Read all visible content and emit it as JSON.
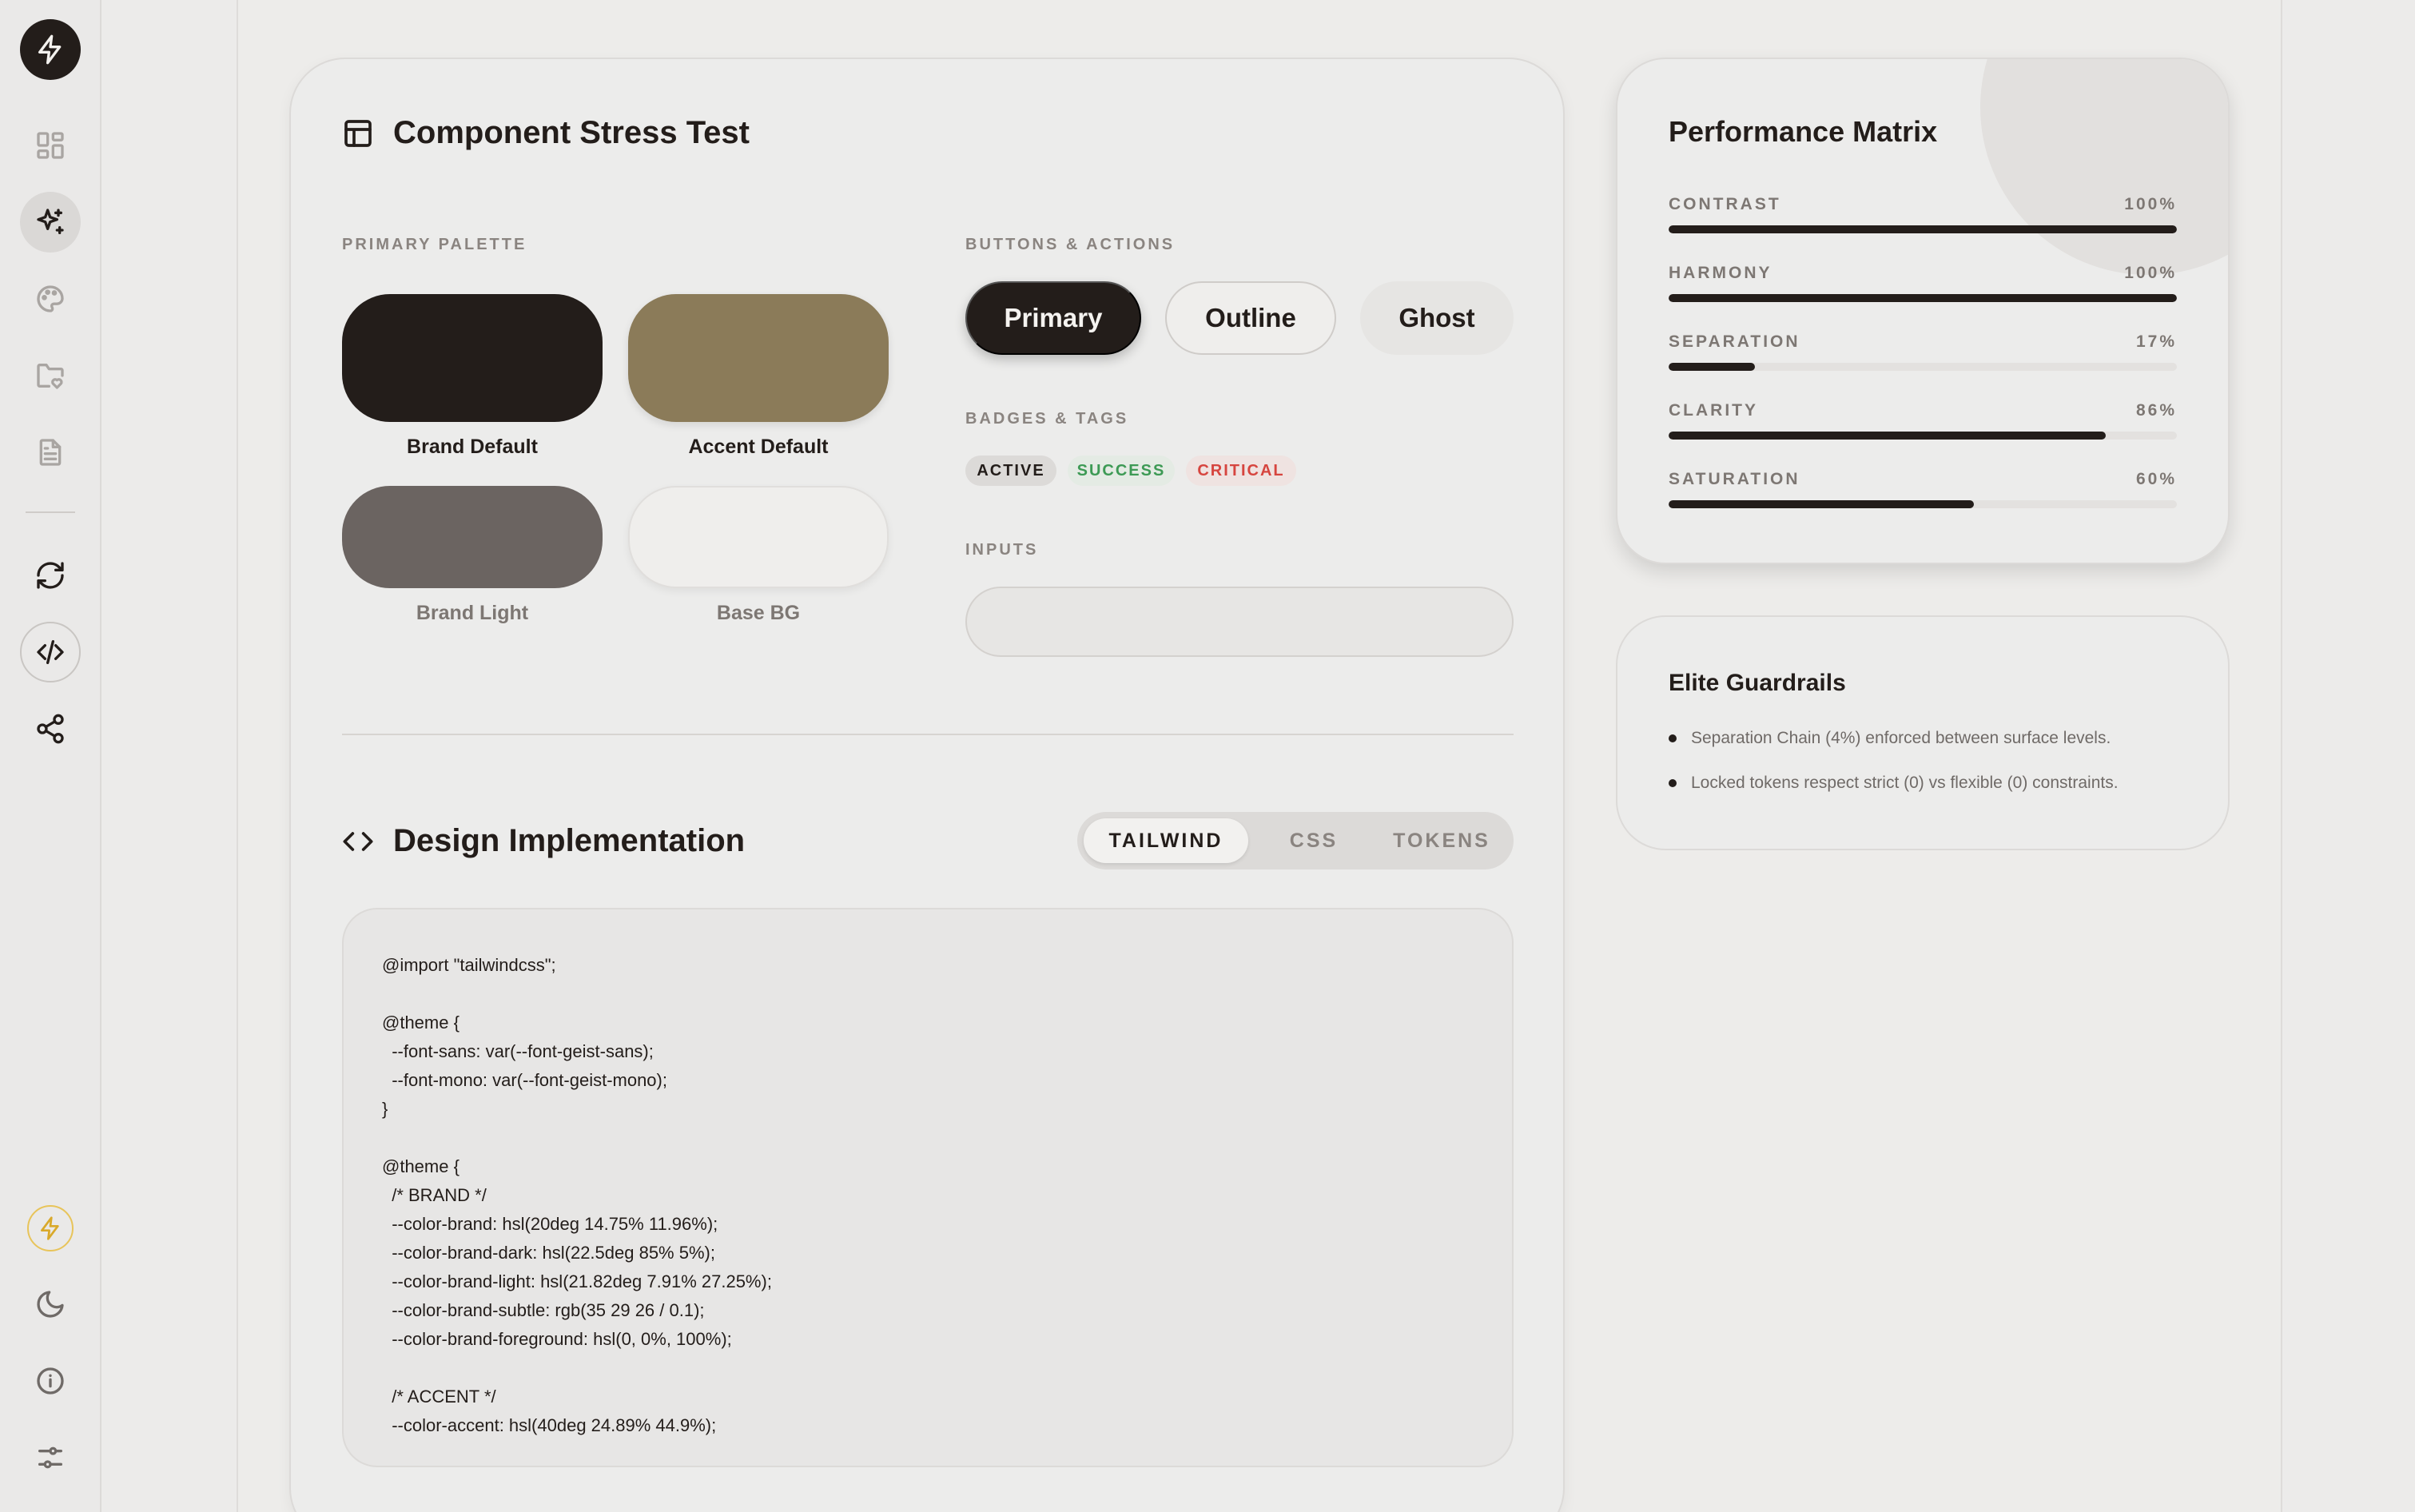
{
  "sidebar": {
    "icons": [
      "bolt-icon",
      "grid-icon",
      "sparkle-icon",
      "palette-icon",
      "folder-heart-icon",
      "file-text-icon",
      "refresh-icon",
      "code-icon",
      "share-icon",
      "bolt-icon",
      "moon-icon",
      "info-icon",
      "sliders-icon"
    ]
  },
  "stress": {
    "title": "Component Stress Test",
    "palette_label": "PRIMARY PALETTE",
    "swatches": [
      {
        "name": "Brand Default",
        "color": "#231d1a"
      },
      {
        "name": "Accent Default",
        "color": "#8b7b59"
      },
      {
        "name": "Brand Light",
        "color": "#6b6461"
      },
      {
        "name": "Base BG",
        "color": "#efeeec"
      }
    ],
    "buttons_label": "BUTTONS & ACTIONS",
    "buttons": {
      "primary": "Primary",
      "outline": "Outline",
      "ghost": "Ghost"
    },
    "badges_label": "BADGES & TAGS",
    "badges": {
      "active": "ACTIVE",
      "success": "SUCCESS",
      "critical": "CRITICAL"
    },
    "inputs_label": "INPUTS",
    "input_value": ""
  },
  "impl": {
    "title": "Design Implementation",
    "tabs": [
      "TAILWIND",
      "CSS",
      "TOKENS"
    ],
    "active_tab": "TAILWIND",
    "code_lines": [
      "@import \"tailwindcss\";",
      "",
      "@theme {",
      "  --font-sans: var(--font-geist-sans);",
      "  --font-mono: var(--font-geist-mono);",
      "}",
      "",
      "@theme {",
      "  /* BRAND */",
      "  --color-brand: hsl(20deg 14.75% 11.96%);",
      "  --color-brand-dark: hsl(22.5deg 85% 5%);",
      "  --color-brand-light: hsl(21.82deg 7.91% 27.25%);",
      "  --color-brand-subtle: rgb(35 29 26 / 0.1);",
      "  --color-brand-foreground: hsl(0, 0%, 100%);",
      "",
      "  /* ACCENT */",
      "  --color-accent: hsl(40deg 24.89% 44.9%);"
    ]
  },
  "performance": {
    "title": "Performance Matrix",
    "metrics": [
      {
        "label": "CONTRAST",
        "value_text": "100%",
        "value": 100
      },
      {
        "label": "HARMONY",
        "value_text": "100%",
        "value": 100
      },
      {
        "label": "SEPARATION",
        "value_text": "17%",
        "value": 17
      },
      {
        "label": "CLARITY",
        "value_text": "86%",
        "value": 86
      },
      {
        "label": "SATURATION",
        "value_text": "60%",
        "value": 60
      }
    ]
  },
  "guardrails": {
    "title": "Elite Guardrails",
    "items": [
      "Separation Chain (4%) enforced between surface levels.",
      "Locked tokens respect strict (0) vs flexible (0) constraints."
    ]
  },
  "colors": {
    "brand": "#231d1a",
    "accent": "#8b7b59",
    "success": "#3d9a55",
    "critical": "#d6453f",
    "warning": "#d9a92a"
  }
}
